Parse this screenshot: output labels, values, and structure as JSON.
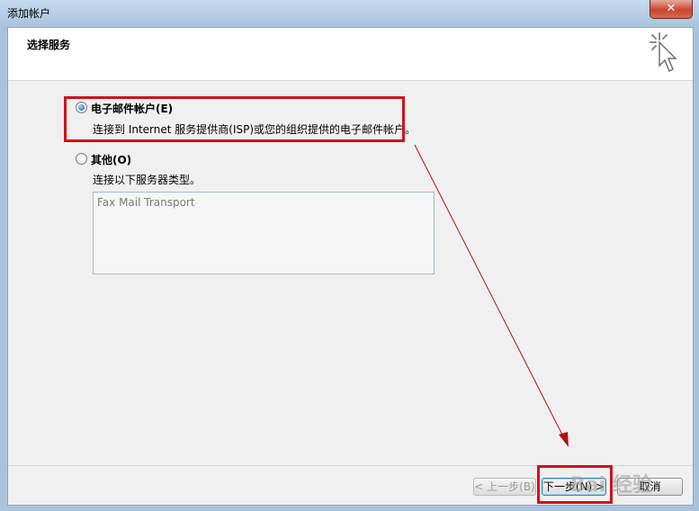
{
  "window": {
    "title": "添加帐户",
    "close_label": "✕"
  },
  "header": {
    "title": "选择服务",
    "icon": "wizard-cursor-icon"
  },
  "options": [
    {
      "label": "电子邮件帐户(E)",
      "description": "连接到 Internet 服务提供商(ISP)或您的组织提供的电子邮件帐户。",
      "checked": true
    },
    {
      "label": "其他(O)",
      "description": "连接以下服务器类型。",
      "checked": false
    }
  ],
  "server_types": [
    "Fax Mail Transport"
  ],
  "buttons": {
    "back": "< 上一步(B)",
    "next": "下一步(N) >",
    "cancel": "取消"
  },
  "watermark": "Bai 经验",
  "colors": {
    "highlight": "#d0121a",
    "arrow": "#b01010"
  }
}
